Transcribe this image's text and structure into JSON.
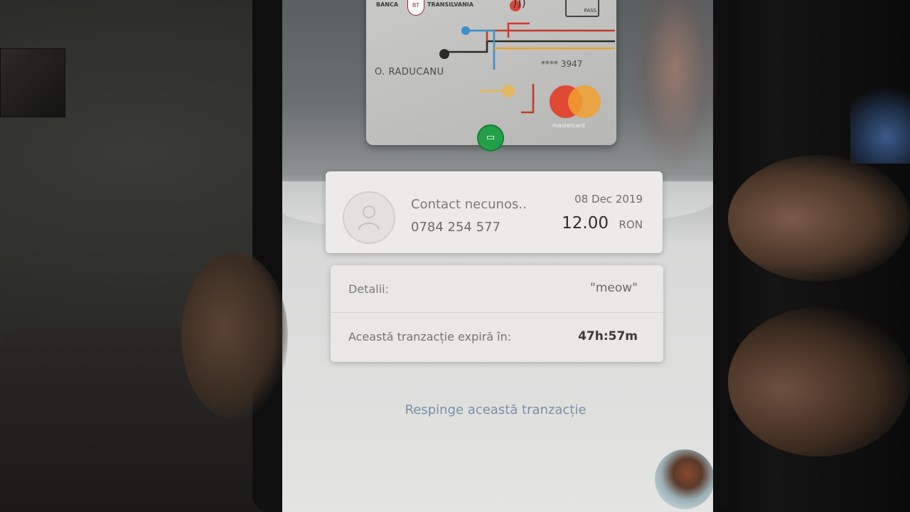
{
  "card": {
    "bank_name_left": "BANCA",
    "bank_logo": "BT",
    "bank_name_right": "TRANSILVANIA",
    "pass_label": "PASS",
    "holder": "O. RADUCANU",
    "number_masked": "**** 3947",
    "network": "mastercard",
    "icons": [
      "contactless-icon",
      "card-pass-icon",
      "green-cash-icon"
    ]
  },
  "transaction": {
    "contact": "Contact necunos..",
    "phone": "0784 254 577",
    "date": "08 Dec 2019",
    "amount": "12.00",
    "currency": "RON"
  },
  "details": {
    "details_label": "Detalii:",
    "details_value": "\"meow\"",
    "expiry_label": "Această tranzacție expiră în:",
    "expiry_value": "47h:57m"
  },
  "actions": {
    "reject_label": "Respinge această tranzacție"
  },
  "colors": {
    "accent_red": "#e2422c",
    "accent_yellow": "#f0a030",
    "green": "#23a04a",
    "link": "#7a8fa6"
  }
}
